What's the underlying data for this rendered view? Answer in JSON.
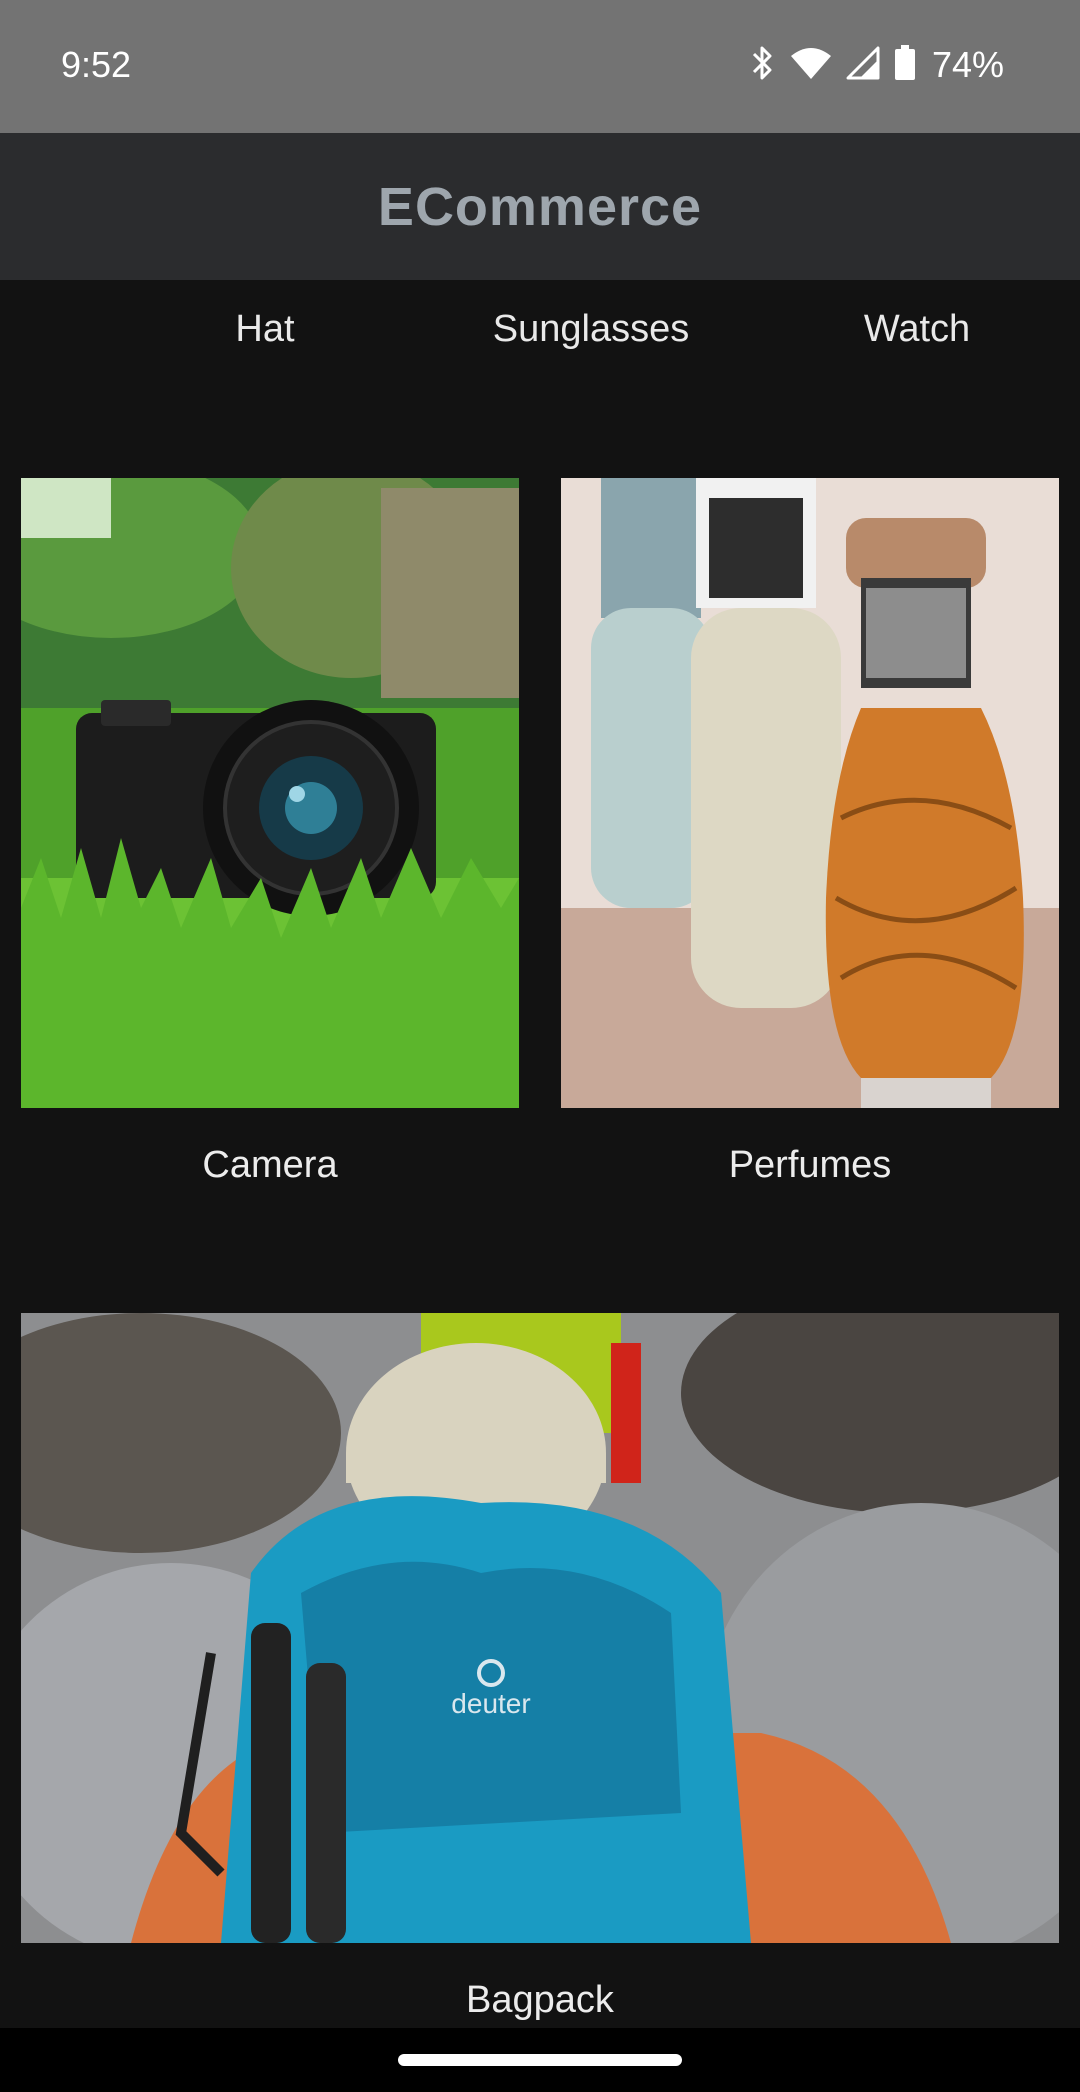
{
  "status_bar": {
    "time": "9:52",
    "battery": "74%",
    "icons": [
      "bluetooth-icon",
      "wifi-icon",
      "signal-icon",
      "battery-icon"
    ]
  },
  "app_bar": {
    "title": "ECommerce"
  },
  "tabs": [
    {
      "label": "Hat"
    },
    {
      "label": "Sunglasses"
    },
    {
      "label": "Watch"
    }
  ],
  "products": [
    {
      "label": "Camera"
    },
    {
      "label": "Perfumes"
    },
    {
      "label": "Bagpack"
    }
  ],
  "colors": {
    "background": "#121212",
    "status_bar": "#737373",
    "app_bar": "#2b2c2e",
    "title": "#9ea6ad"
  }
}
